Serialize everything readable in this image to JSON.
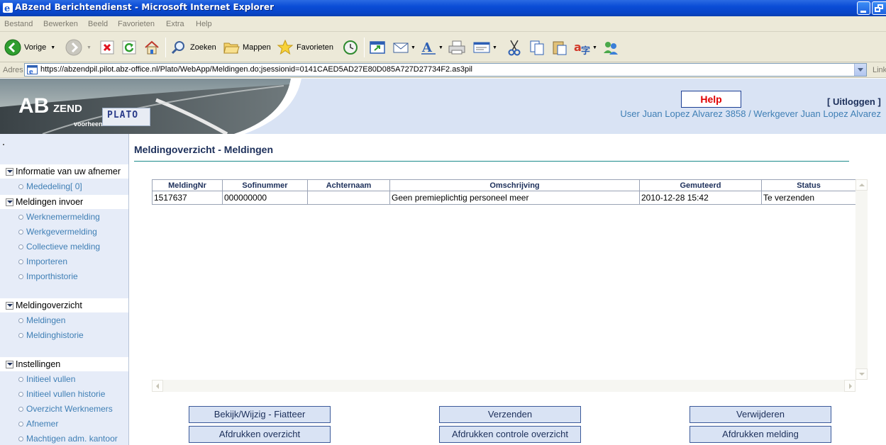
{
  "window": {
    "title": "ABzend Berichtendienst - Microsoft Internet Explorer"
  },
  "menu": [
    "Bestand",
    "Bewerken",
    "Beeld",
    "Favorieten",
    "Extra",
    "Help"
  ],
  "toolbar": {
    "back_label": "Vorige",
    "search_label": "Zoeken",
    "folders_label": "Mappen",
    "favorites_label": "Favorieten"
  },
  "address": {
    "label": "Adres",
    "url": "https://abzendpil.pilot.abz-office.nl/Plato/WebApp/Meldingen.do;jsessionid=0141CAED5AD27E80D085A727D27734F2.as3pil",
    "links_label": "Link"
  },
  "header": {
    "logo_ab": "AB",
    "logo_zend": "ZEND",
    "logo_formerly": "voorheen",
    "logo_plato": "PLATO",
    "help_label": "Help",
    "logout_label": "[ Uitloggen ]",
    "user_line": "User Juan Lopez Alvarez 3858 / Werkgever Juan Lopez Alvarez"
  },
  "sidebar": {
    "sections": [
      {
        "title": "Informatie van uw afnemer",
        "items": [
          "Mededeling[ 0]"
        ]
      },
      {
        "title": "Meldingen invoer",
        "items": [
          "Werknemermelding",
          "Werkgevermelding",
          "Collectieve melding",
          "Importeren",
          "Importhistorie"
        ]
      },
      {
        "title": "Meldingoverzicht",
        "items": [
          "Meldingen",
          "Meldinghistorie"
        ]
      },
      {
        "title": "Instellingen",
        "items": [
          "Initieel vullen",
          "Initieel vullen historie",
          "Overzicht Werknemers",
          "Afnemer",
          "Machtigen adm. kantoor"
        ]
      }
    ]
  },
  "content": {
    "title": "Meldingoverzicht - Meldingen",
    "table": {
      "headers": [
        "MeldingNr",
        "Sofinummer",
        "Achternaam",
        "Omschrijving",
        "Gemuteerd",
        "Status"
      ],
      "rows": [
        [
          "1517637",
          "000000000",
          "",
          "Geen premieplichtig personeel meer",
          "2010-12-28 15:42",
          "Te verzenden"
        ]
      ]
    },
    "buttons": {
      "view_edit": "Bekijk/Wijzig - Fiatteer",
      "send": "Verzenden",
      "delete": "Verwijderen",
      "print_overview": "Afdrukken overzicht",
      "print_check": "Afdrukken controle overzicht",
      "print_report": "Afdrukken melding"
    }
  }
}
